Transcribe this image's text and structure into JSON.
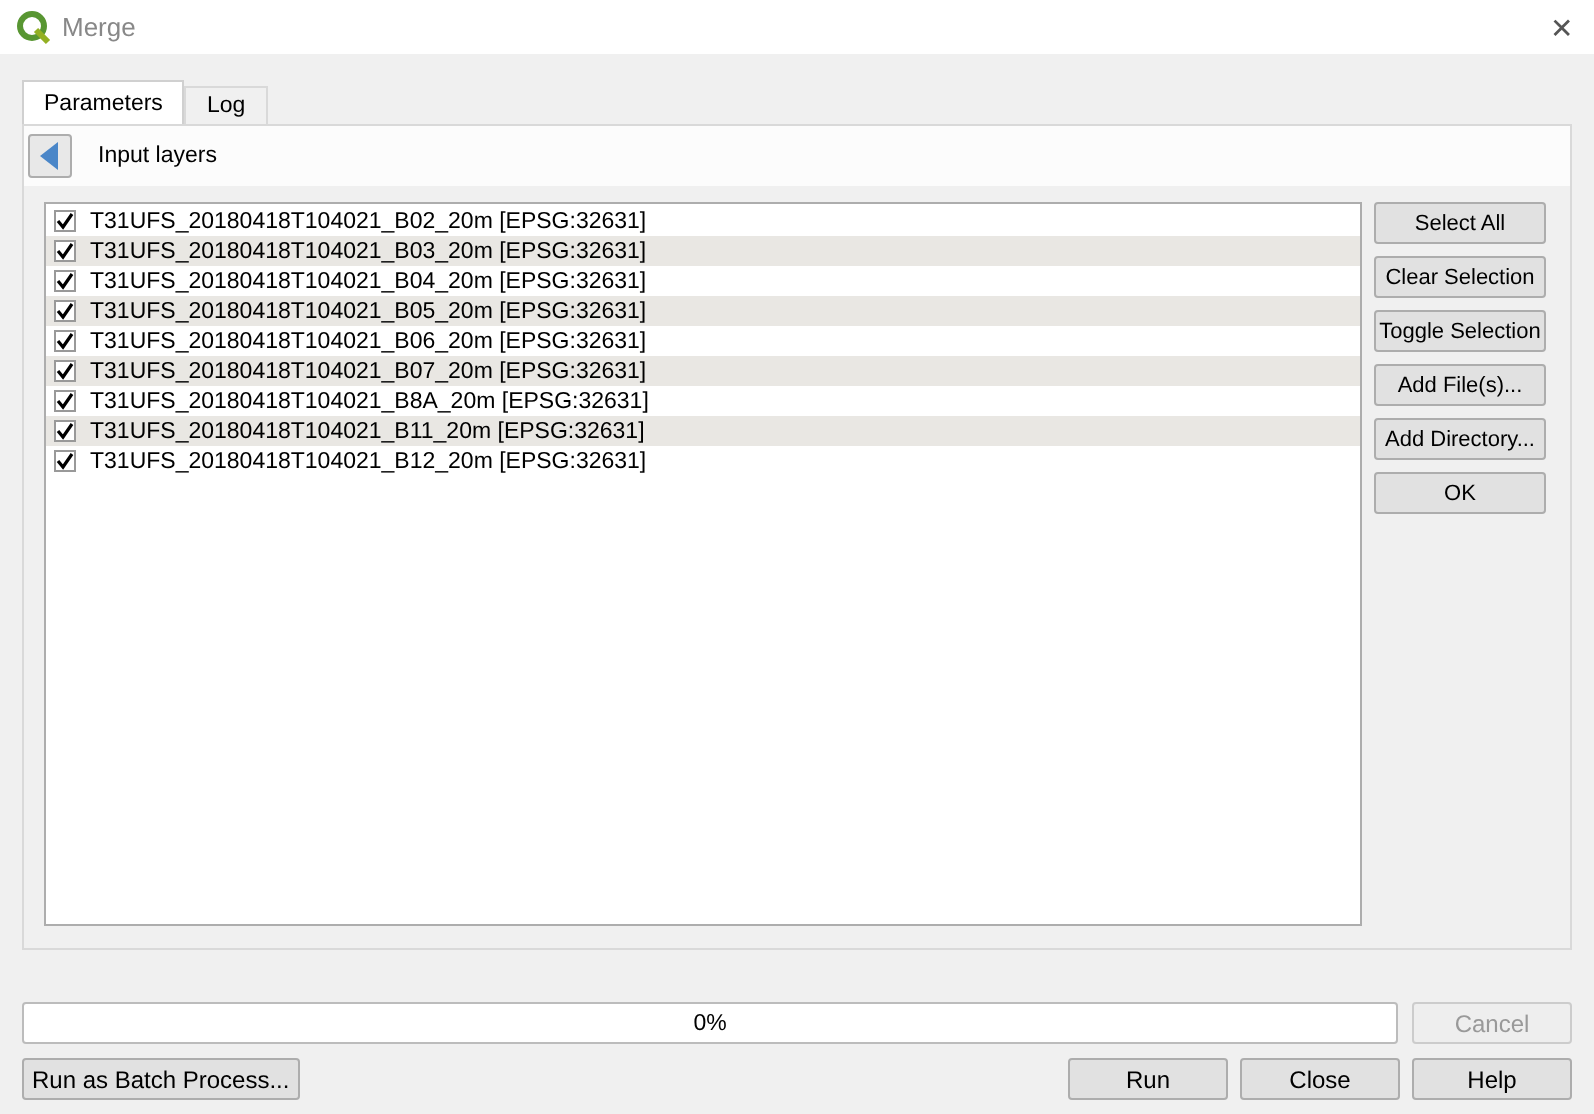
{
  "window": {
    "title": "Merge",
    "close": "✕"
  },
  "tabs": [
    {
      "label": "Parameters",
      "selected": true
    },
    {
      "label": "Log",
      "selected": false
    }
  ],
  "header": {
    "label": "Input layers"
  },
  "layers": [
    {
      "name": "T31UFS_20180418T104021_B02_20m [EPSG:32631]",
      "checked": true
    },
    {
      "name": "T31UFS_20180418T104021_B03_20m [EPSG:32631]",
      "checked": true
    },
    {
      "name": "T31UFS_20180418T104021_B04_20m [EPSG:32631]",
      "checked": true
    },
    {
      "name": "T31UFS_20180418T104021_B05_20m [EPSG:32631]",
      "checked": true
    },
    {
      "name": "T31UFS_20180418T104021_B06_20m [EPSG:32631]",
      "checked": true
    },
    {
      "name": "T31UFS_20180418T104021_B07_20m [EPSG:32631]",
      "checked": true
    },
    {
      "name": "T31UFS_20180418T104021_B8A_20m [EPSG:32631]",
      "checked": true
    },
    {
      "name": "T31UFS_20180418T104021_B11_20m [EPSG:32631]",
      "checked": true
    },
    {
      "name": "T31UFS_20180418T104021_B12_20m [EPSG:32631]",
      "checked": true
    }
  ],
  "side_buttons": [
    "Select All",
    "Clear Selection",
    "Toggle Selection",
    "Add File(s)...",
    "Add Directory...",
    "OK"
  ],
  "progress": {
    "level": 0,
    "reading": "0%"
  },
  "cancel": {
    "label": "Cancel",
    "disabled": true
  },
  "batch_button": "Run as Batch Process...",
  "buttons": [
    "Run",
    "Close",
    "Help"
  ]
}
